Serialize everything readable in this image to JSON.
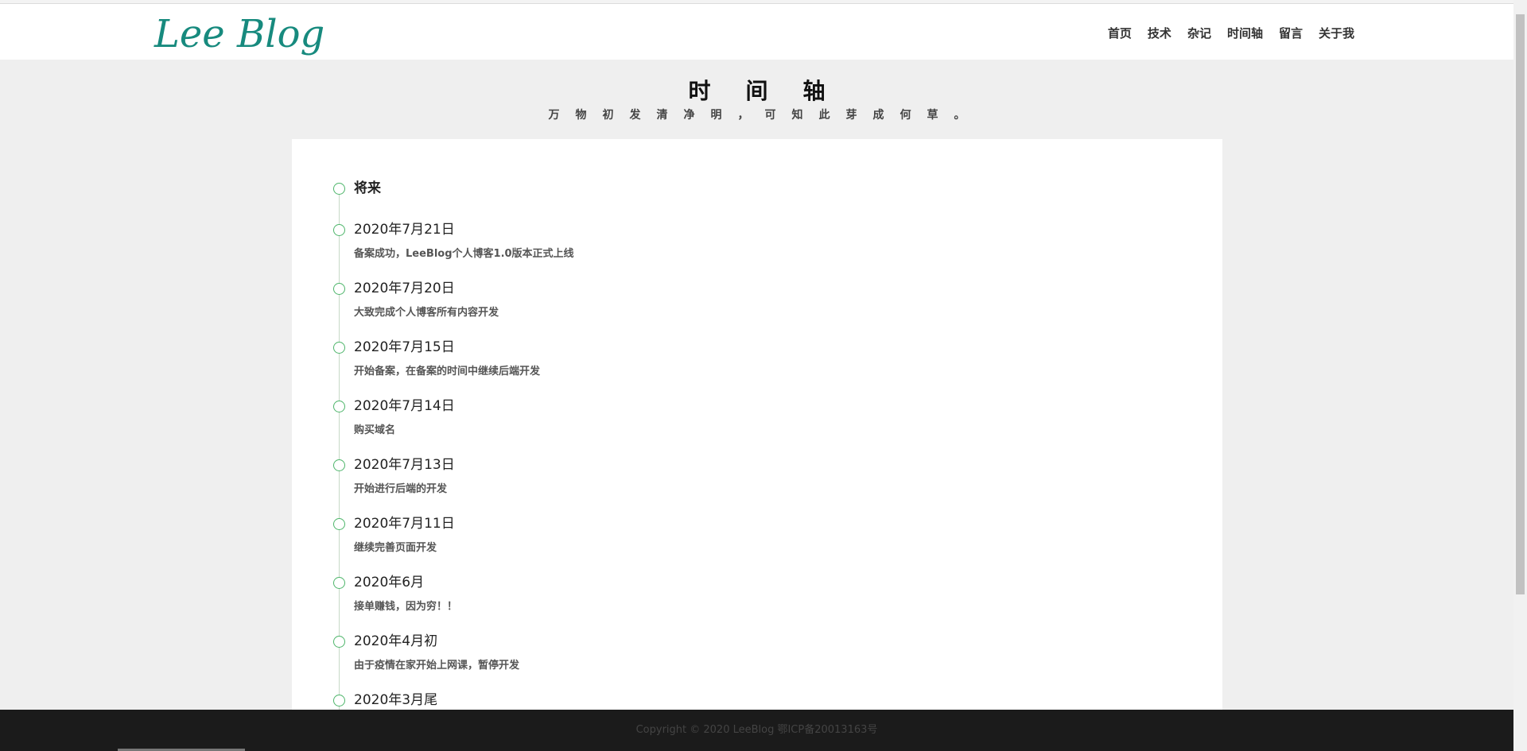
{
  "header": {
    "logo": "Lee Blog",
    "nav": [
      "首页",
      "技术",
      "杂记",
      "时间轴",
      "留言",
      "关于我"
    ]
  },
  "page": {
    "title": "时间轴",
    "subtitle": "万物初发清净明，可知此芽成何草。"
  },
  "timeline": {
    "items": [
      {
        "date": "将来",
        "desc": ""
      },
      {
        "date": "2020年7月21日",
        "desc": "备案成功，LeeBlog个人博客1.0版本正式上线"
      },
      {
        "date": "2020年7月20日",
        "desc": "大致完成个人博客所有内容开发"
      },
      {
        "date": "2020年7月15日",
        "desc": "开始备案，在备案的时间中继续后端开发"
      },
      {
        "date": "2020年7月14日",
        "desc": "购买域名"
      },
      {
        "date": "2020年7月13日",
        "desc": "开始进行后端的开发"
      },
      {
        "date": "2020年7月11日",
        "desc": "继续完善页面开发"
      },
      {
        "date": "2020年6月",
        "desc": "接单赚钱，因为穷！！"
      },
      {
        "date": "2020年4月初",
        "desc": "由于疫情在家开始上网课，暂停开发"
      },
      {
        "date": "2020年3月尾",
        "desc": ""
      }
    ]
  },
  "footer": {
    "text": "Copyright © 2020 LeeBlog 鄂ICP备20013163号"
  }
}
